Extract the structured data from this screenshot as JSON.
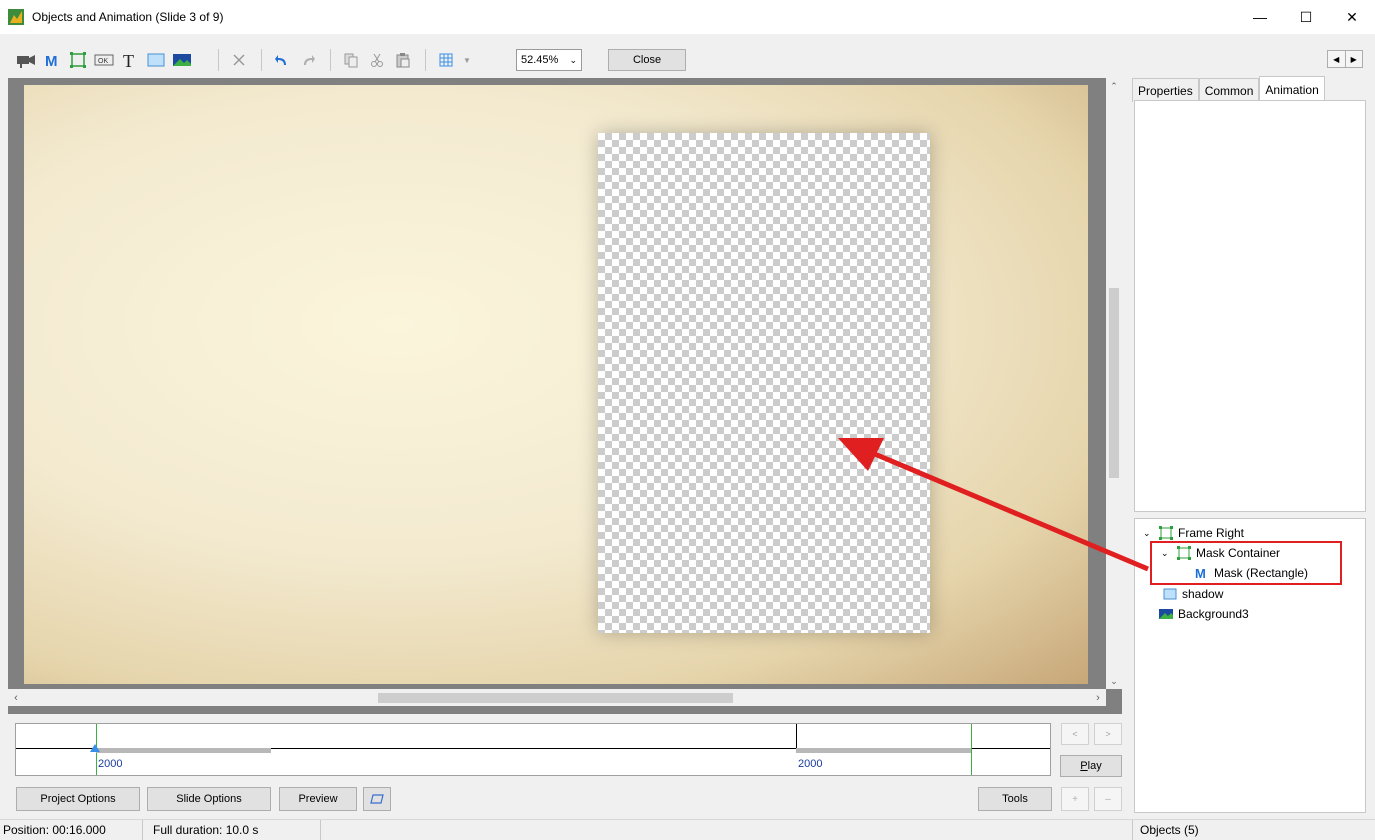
{
  "window": {
    "title": "Objects and Animation  (Slide 3 of 9)"
  },
  "toolbar": {
    "zoom": "52.45%",
    "close_label": "Close"
  },
  "timeline": {
    "start_label": "2000",
    "end_label": "2000"
  },
  "buttons": {
    "play_prefix": "P",
    "play_rest": "lay",
    "project_options": "Project Options",
    "slide_options": "Slide Options",
    "preview": "Preview",
    "tools": "Tools"
  },
  "status": {
    "position": "Position:  00:16.000",
    "duration": "Full duration:  10.0 s",
    "objects": "Objects (5)"
  },
  "tabs": [
    {
      "label": "Properties"
    },
    {
      "label": "Common"
    },
    {
      "label": "Animation"
    }
  ],
  "tree": [
    {
      "label": "Frame Right"
    },
    {
      "label": "Mask Container"
    },
    {
      "label": "Mask (Rectangle)"
    },
    {
      "label": "shadow"
    },
    {
      "label": "Background3"
    }
  ],
  "colors": {
    "accent_blue": "#1f6fd6",
    "highlight_red": "#e02020",
    "frame_green": "#2e9e3e"
  }
}
